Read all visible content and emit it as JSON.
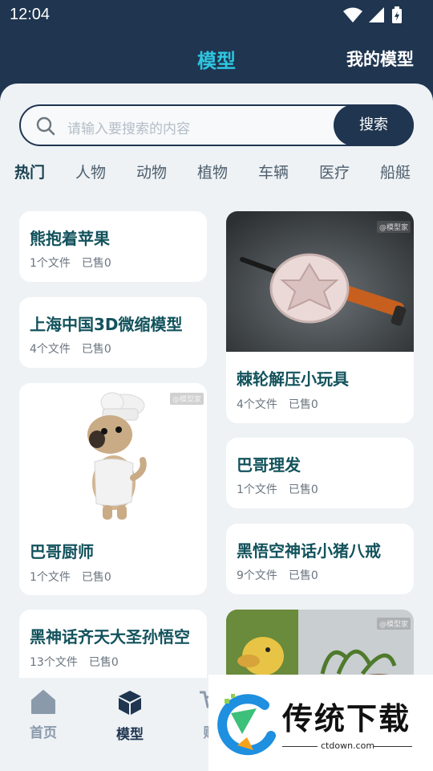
{
  "status_bar": {
    "time": "12:04"
  },
  "header": {
    "title": "模型",
    "right_link": "我的模型"
  },
  "search": {
    "placeholder": "请输入要搜索的内容",
    "button": "搜索"
  },
  "categories": [
    "热门",
    "人物",
    "动物",
    "植物",
    "车辆",
    "医疗",
    "船艇"
  ],
  "cards": {
    "c1": {
      "title": "熊抱着苹果",
      "files": "1个文件",
      "sold": "已售0"
    },
    "c2": {
      "title": "上海中国3D微缩模型",
      "files": "4个文件",
      "sold": "已售0"
    },
    "c3": {
      "title": "巴哥厨师",
      "files": "1个文件",
      "sold": "已售0",
      "watermark": "@模型家"
    },
    "c4": {
      "title": "黑神话齐天大圣孙悟空",
      "files": "13个文件",
      "sold": "已售0"
    },
    "c5": {
      "title": "棘轮解压小玩具",
      "files": "4个文件",
      "sold": "已售0",
      "watermark": "@模型家"
    },
    "c6": {
      "title": "巴哥理发",
      "files": "1个文件",
      "sold": "已售0"
    },
    "c7": {
      "title": "黑悟空神话小猪八戒",
      "files": "9个文件",
      "sold": "已售0"
    },
    "c8": {
      "watermark": "@模型家"
    }
  },
  "bottom_nav": {
    "home": "首页",
    "models": "模型",
    "cart": "购"
  },
  "overlay_ad": {
    "brand": "传统下载",
    "domain": "ctdown.com"
  },
  "colors": {
    "dark": "#1f3550",
    "accent": "#2ec5e0",
    "title_text": "#12525c",
    "background": "#eef2f5"
  }
}
